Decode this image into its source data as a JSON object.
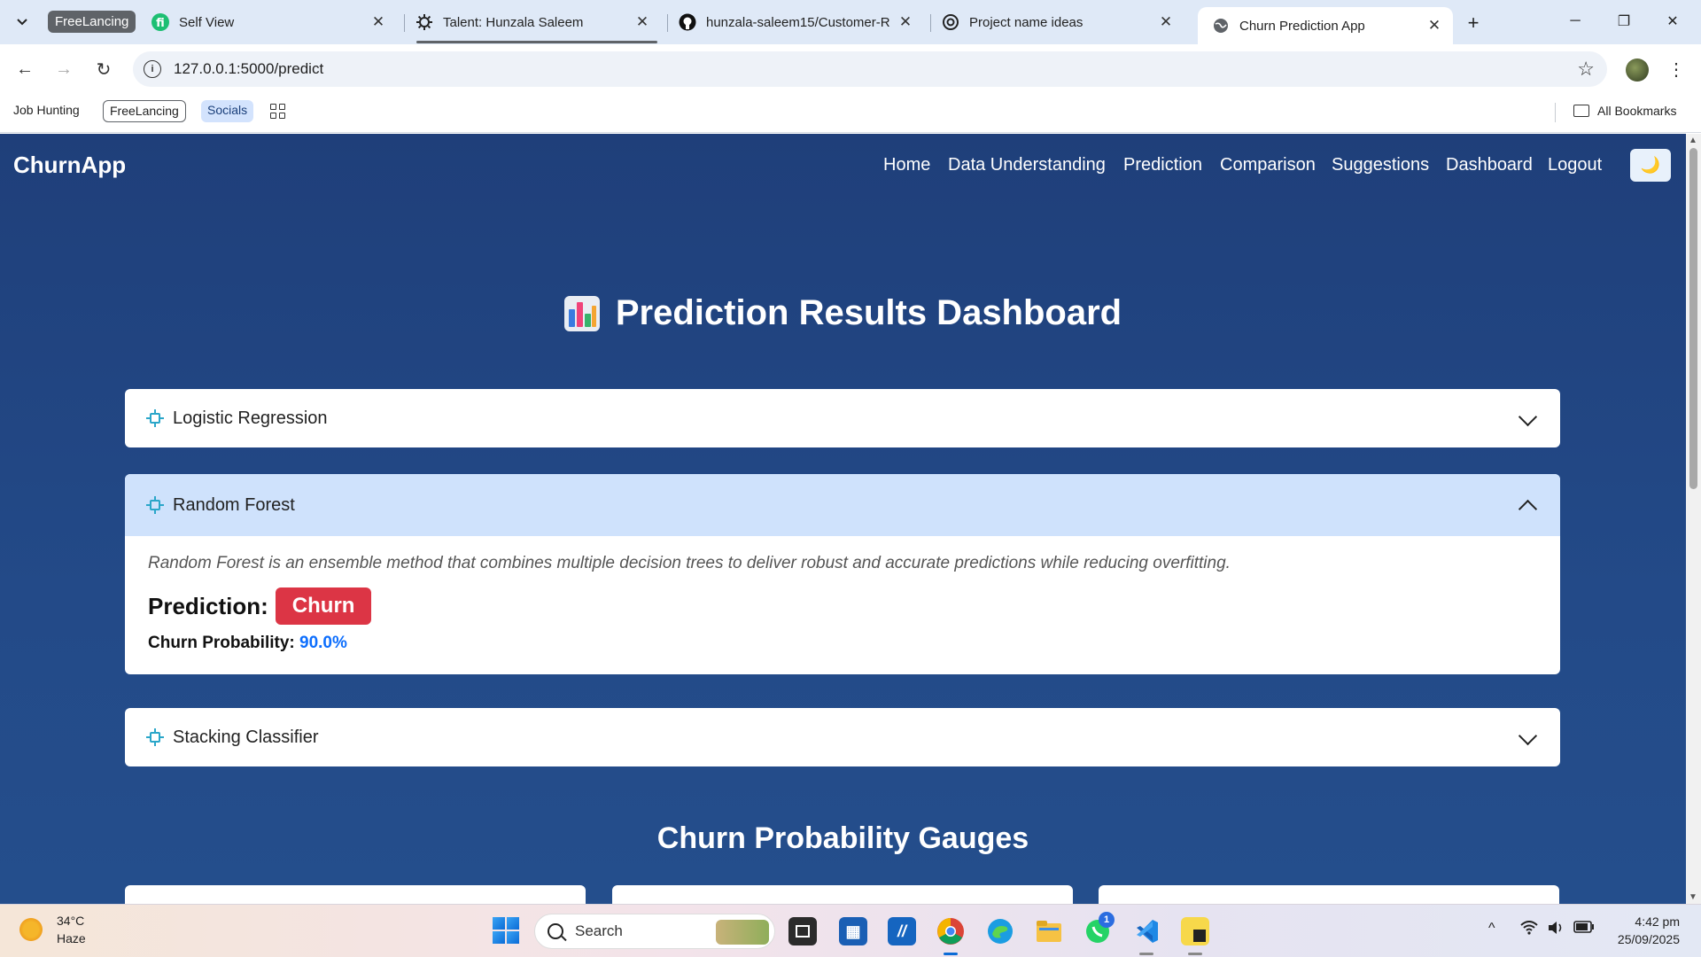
{
  "browser": {
    "group_chip": "FreeLancing",
    "tabs": [
      {
        "title": "Self View",
        "icon": "fiverr-icon"
      },
      {
        "title": "Talent: Hunzala Saleem",
        "icon": "gear-icon"
      },
      {
        "title": "hunzala-saleem15/Customer-R",
        "icon": "github-icon"
      },
      {
        "title": "Project name ideas",
        "icon": "openai-icon"
      },
      {
        "title": "Churn Prediction App",
        "icon": "globe-icon"
      }
    ],
    "url": "127.0.0.1:5000/predict",
    "bookmarks": [
      "Job Hunting",
      "FreeLancing",
      "Socials"
    ],
    "all_bookmarks": "All Bookmarks"
  },
  "app": {
    "brand": "ChurnApp",
    "nav": [
      "Home",
      "Data Understanding",
      "Prediction",
      "Comparison",
      "Suggestions",
      "Dashboard",
      "Logout"
    ],
    "theme_toggle_icon": "moon-icon",
    "page_title": "Prediction Results Dashboard",
    "models": [
      {
        "name": "Logistic Regression",
        "expanded": false
      },
      {
        "name": "Random Forest",
        "expanded": true,
        "description": "Random Forest is an ensemble method that combines multiple decision trees to deliver robust and accurate predictions while reducing overfitting.",
        "prediction_label": "Prediction:",
        "prediction": "Churn",
        "probability_label": "Churn Probability:",
        "probability": "90.0%"
      },
      {
        "name": "Stacking Classifier",
        "expanded": false
      }
    ],
    "gauges_title": "Churn Probability Gauges"
  },
  "taskbar": {
    "weather_temp": "34°C",
    "weather_desc": "Haze",
    "search_placeholder": "Search",
    "whatsapp_badge": "1",
    "time": "4:42 pm",
    "date": "25/09/2025"
  },
  "colors": {
    "page_bg": "#1f3f7a",
    "churn_badge": "#dc3545",
    "probability": "#0d6efd",
    "accordion_open": "#cfe2fc"
  }
}
